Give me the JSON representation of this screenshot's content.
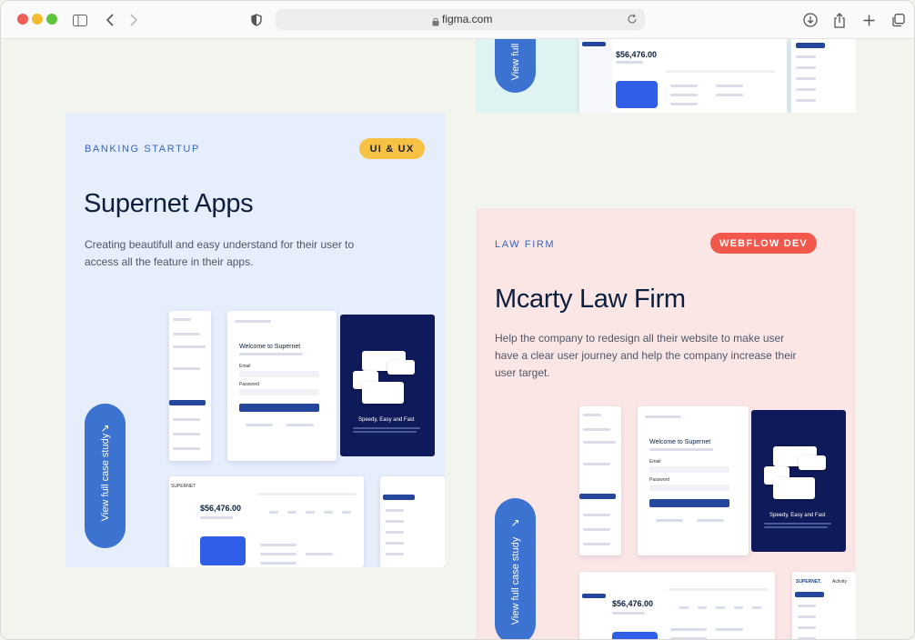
{
  "browser": {
    "url": "figma.com",
    "traffic_lights": {
      "close": "#ee5e57",
      "minimize": "#f4bd2f",
      "maximize": "#5fc53e"
    },
    "icons": [
      "sidebar-icon",
      "back-icon",
      "forward-icon",
      "shield-icon",
      "lock-icon",
      "reload-icon",
      "download-icon",
      "share-icon",
      "new-tab-icon",
      "tabs-icon"
    ]
  },
  "cards": {
    "banking": {
      "kicker": "BANKING STARTUP",
      "chip": "UI & UX",
      "chip_color": "#f7c244",
      "title": "Supernet Apps",
      "description": "Creating beautifull and easy understand for their user to access all the feature in their apps.",
      "cta": "View full case study",
      "mock": {
        "welcome": "Welcome to Supernet",
        "email_label": "Email",
        "password_label": "Password",
        "hero_text": "Speedy, Easy and Fast",
        "balance": "$56,476.00",
        "brand": "SUPERNET"
      }
    },
    "law": {
      "kicker": "LAW FIRM",
      "chip": "WEBFLOW DEV",
      "chip_color": "#f2574c",
      "title": "Mcarty Law Firm",
      "description": "Help the company to redesign all their website to make user have a  clear user journey and help the company increase their user target.",
      "cta": "View full case study",
      "mock": {
        "welcome": "Welcome to Supernet",
        "email_label": "Email",
        "password_label": "Password",
        "hero_text": "Speedy, Easy and Fast",
        "balance": "$56,476.00",
        "brand": "SUPERNET.",
        "activity": "Activity"
      }
    },
    "top": {
      "cta": "View full",
      "balance": "$56,476.00"
    }
  }
}
